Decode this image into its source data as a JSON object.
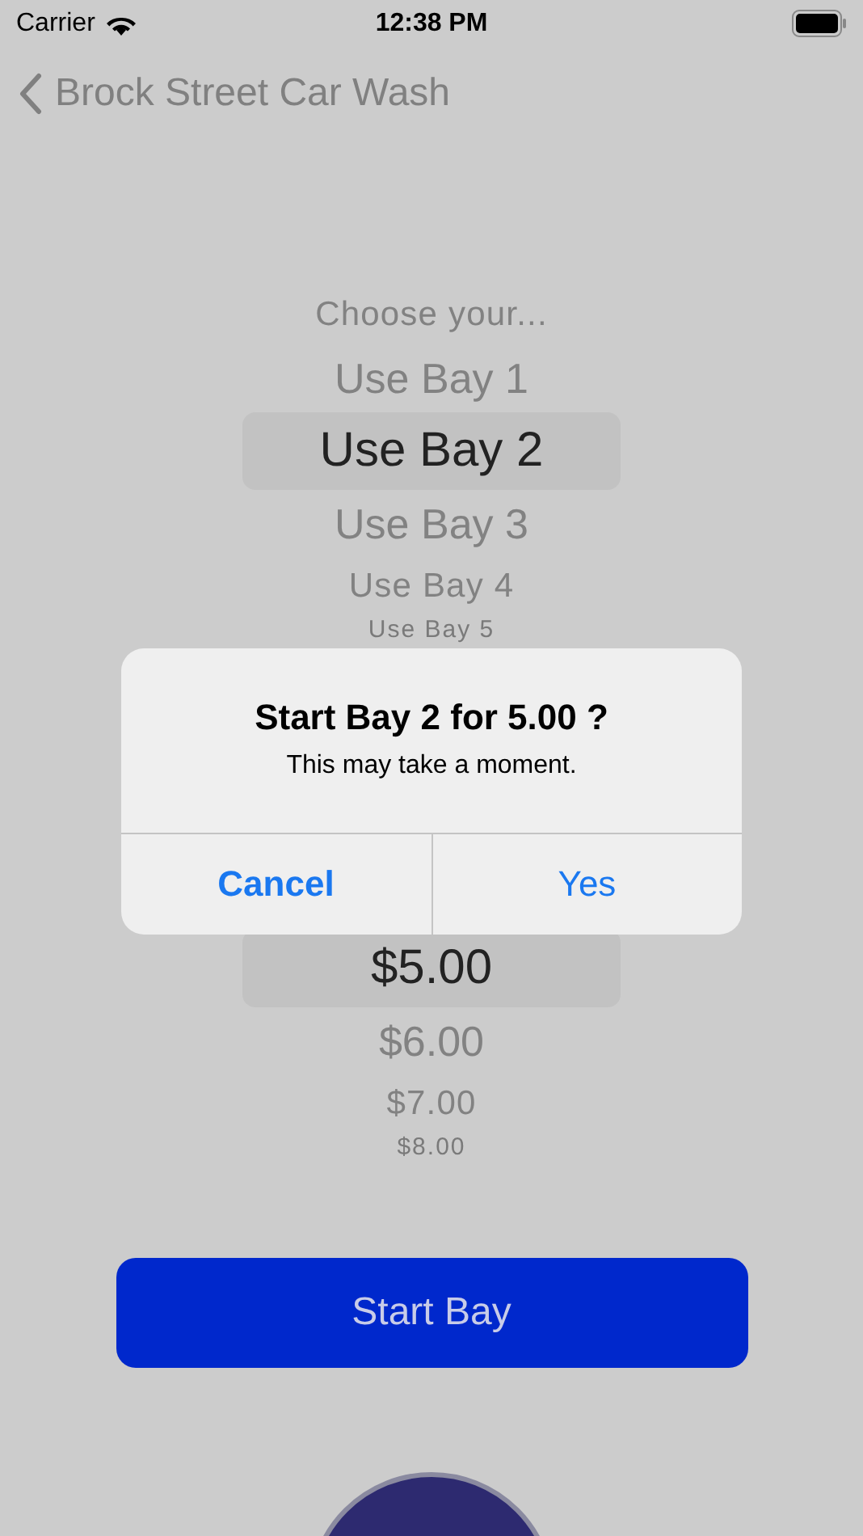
{
  "status_bar": {
    "carrier": "Carrier",
    "time": "12:38 PM"
  },
  "nav": {
    "back_label": "Brock Street Car Wash"
  },
  "bay_picker": {
    "items": [
      {
        "label": "Choose your...",
        "selected": false
      },
      {
        "label": "Use Bay 1",
        "selected": false
      },
      {
        "label": "Use Bay 2",
        "selected": true
      },
      {
        "label": "Use Bay 3",
        "selected": false
      },
      {
        "label": "Use Bay 4",
        "selected": false
      },
      {
        "label": "Use Bay 5",
        "selected": false
      }
    ]
  },
  "price_picker": {
    "items": [
      {
        "label": "$5.00",
        "selected": true
      },
      {
        "label": "$6.00",
        "selected": false
      },
      {
        "label": "$7.00",
        "selected": false
      },
      {
        "label": "$8.00",
        "selected": false
      }
    ]
  },
  "start_button": {
    "label": "Start Bay"
  },
  "alert": {
    "title": "Start Bay 2 for 5.00 ?",
    "message": "This may take a moment.",
    "actions": [
      {
        "label": "Cancel",
        "kind": "cancel"
      },
      {
        "label": "Yes",
        "kind": "default"
      }
    ]
  }
}
